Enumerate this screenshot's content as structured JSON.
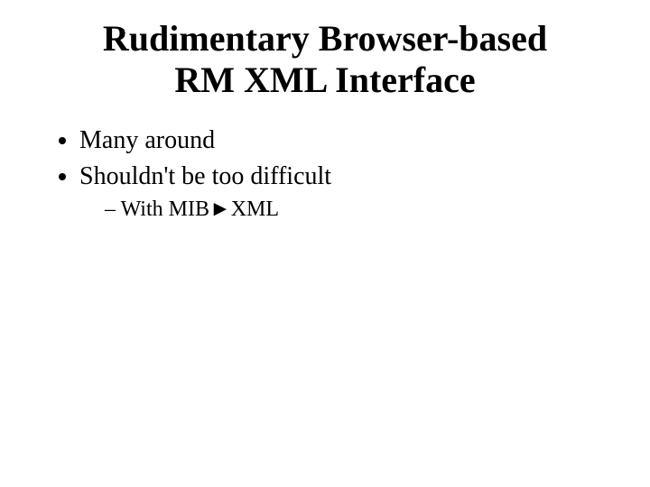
{
  "title_line1": "Rudimentary Browser-based",
  "title_line2": "RM XML Interface",
  "bullets": {
    "b0": "Many around",
    "b1": "Shouldn't be too difficult",
    "b1_sub0": "With MIB►XML"
  }
}
